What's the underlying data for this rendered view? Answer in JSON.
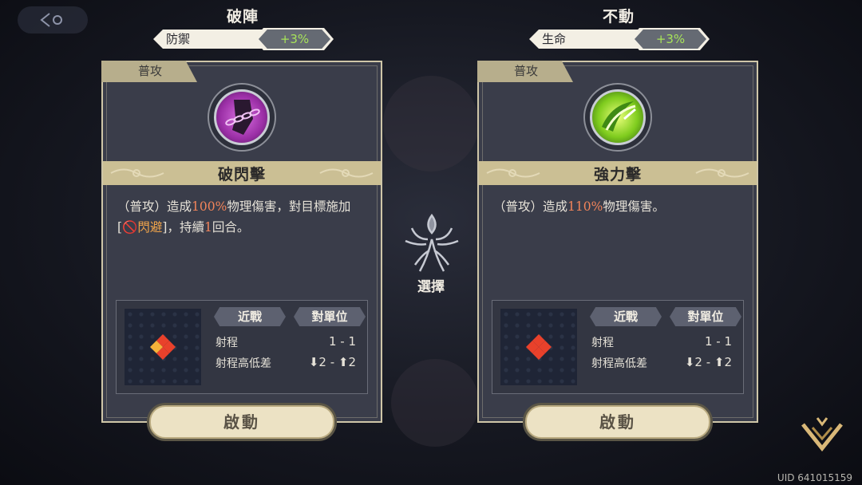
{
  "left": {
    "title": "破陣",
    "bonus_stat": "防禦",
    "bonus_value": "+3%",
    "type_tab": "普攻",
    "skill_name": "破閃擊",
    "desc": {
      "p1": "（普攻）造成",
      "pct": "100%",
      "p2": "物理傷害，對目標施加",
      "br_open": "[",
      "status": "閃避",
      "br_close": "]，持續",
      "turns": "1",
      "p3": "回合。"
    },
    "tag1": "近戰",
    "tag2": "對單位",
    "range_label": "射程",
    "range_value": "1 - 1",
    "height_label": "射程高低差",
    "height_value": "⬇2 - ⬆2",
    "button": "啟動"
  },
  "right": {
    "title": "不動",
    "bonus_stat": "生命",
    "bonus_value": "+3%",
    "type_tab": "普攻",
    "skill_name": "強力擊",
    "desc": {
      "p1": "（普攻）造成",
      "pct": "110%",
      "p2": "物理傷害。"
    },
    "tag1": "近戰",
    "tag2": "對單位",
    "range_label": "射程",
    "range_value": "1 - 1",
    "height_label": "射程高低差",
    "height_value": "⬇2 - ⬆2",
    "button": "啟動"
  },
  "center_label": "選擇",
  "uid": "UID 641015159",
  "colors": {
    "accent_green": "#a7e35a",
    "highlight": "#f2845a",
    "gold": "#cbbf94"
  },
  "icons": {
    "back": "back-arrow-icon",
    "left_skill": "chain-fist-icon",
    "right_skill": "green-slash-icon",
    "center": "tree-emblem-icon",
    "corner": "chevron-emblem-icon"
  }
}
